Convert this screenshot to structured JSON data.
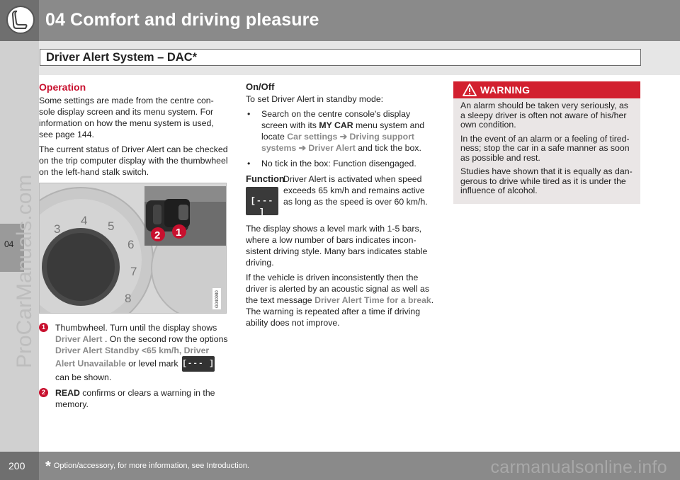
{
  "header": {
    "title": "04 Comfort and driving pleasure",
    "icon": "seat-icon"
  },
  "section": {
    "title": "Driver Alert System – DAC*"
  },
  "side": {
    "tab_label": "04",
    "watermark": "ProCarManuals.com"
  },
  "col1": {
    "heading": "Operation",
    "para1": "Some settings are made from the centre con-sole display screen and its menu system. For information on how the menu system is used, see page 144.",
    "para2": "The current status of Driver Alert can be checked on the trip computer display with the thumbwheel on the left-hand stalk switch.",
    "figure": {
      "callout_1": "1",
      "callout_2": "2",
      "gauge_numbers": [
        "3",
        "4",
        "5",
        "6",
        "7",
        "8"
      ],
      "code": "G040980"
    },
    "item1": {
      "num": "1",
      "text_a": "Thumbwheel. Turn until the display shows ",
      "term_a": "Driver Alert",
      "text_b": " . On the second row the options ",
      "term_b": "Driver Alert Standby <65 km/h, Driver Alert Unavailable",
      "text_c": " or level mark ",
      "icon_text": "[--- ]",
      "text_d": " can be shown."
    },
    "item2": {
      "num": "2",
      "term": "READ",
      "text": " confirms or clears a warning in the memory."
    }
  },
  "col2": {
    "onoff_heading": "On/Off",
    "onoff_intro": "To set Driver Alert in standby mode:",
    "bullet1": {
      "text_a": "Search on the centre console's display screen with its ",
      "bold": "MY CAR",
      "text_b": " menu system and locate ",
      "path": "Car settings ➔ Driving support systems ➔ Driver Alert",
      "text_c": " and tick the box."
    },
    "bullet2": "No tick in the box: Function disengaged.",
    "function_heading": "Function",
    "function_icon_text": "[--- ]",
    "function_text": "Driver Alert is activated when speed exceeds 65 km/h and remains active as long as the speed is over 60 km/h.",
    "para_level": "The display shows a level mark with 1-5 bars, where a low number of bars indicates incon-sistent driving style. Many bars indicates stable driving.",
    "para_inconsistent_a": "If the vehicle is driven inconsistently then the driver is alerted by an acoustic signal as well as the text message ",
    "para_inconsistent_term": "Driver Alert Time for a break",
    "para_inconsistent_b": ". The warning is repeated after a time if driving ability does not improve."
  },
  "warning": {
    "title": "WARNING",
    "icon": "warning-triangle-icon",
    "p1": "An alarm should be taken very seriously, as a sleepy driver is often not aware of his/her own condition.",
    "p2": "In the event of an alarm or a feeling of tired-ness; stop the car in a safe manner as soon as possible and rest.",
    "p3": "Studies have shown that it is equally as dan-gerous to drive while tired as it is under the influence of alcohol."
  },
  "footer": {
    "page_number": "200",
    "star": "*",
    "note": "Option/accessory, for more information, see Introduction.",
    "watermark": "carmanualsonline.info"
  },
  "colors": {
    "accent_red": "#c8102e",
    "header_gray": "#8a8a8a",
    "term_gray": "#8a8a8a"
  }
}
